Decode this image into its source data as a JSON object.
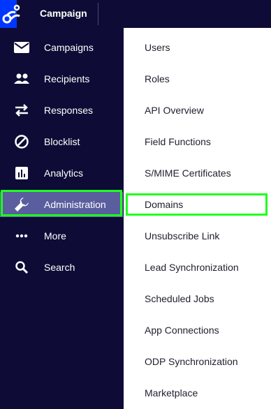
{
  "app": {
    "title": "Campaign",
    "accent_color": "#0037ff",
    "sidebar_bg": "#0e0c36",
    "active_bg": "#5a5e9e",
    "highlight_color": "#1fff1f"
  },
  "sidebar": {
    "items": [
      {
        "label": "Campaigns",
        "icon": "envelope-icon"
      },
      {
        "label": "Recipients",
        "icon": "people-icon"
      },
      {
        "label": "Responses",
        "icon": "swap-arrows-icon"
      },
      {
        "label": "Blocklist",
        "icon": "block-icon"
      },
      {
        "label": "Analytics",
        "icon": "bar-chart-icon"
      },
      {
        "label": "Administration",
        "icon": "wrench-icon",
        "active": true
      },
      {
        "label": "More",
        "icon": "dots-icon"
      },
      {
        "label": "Search",
        "icon": "search-icon"
      }
    ]
  },
  "submenu": {
    "items": [
      {
        "label": "Users"
      },
      {
        "label": "Roles"
      },
      {
        "label": "API Overview"
      },
      {
        "label": "Field Functions"
      },
      {
        "label": "S/MIME Certificates"
      },
      {
        "label": "Domains",
        "highlighted": true
      },
      {
        "label": "Unsubscribe Link"
      },
      {
        "label": "Lead Synchronization"
      },
      {
        "label": "Scheduled Jobs"
      },
      {
        "label": "App Connections"
      },
      {
        "label": "ODP Synchronization"
      },
      {
        "label": "Marketplace"
      }
    ]
  }
}
